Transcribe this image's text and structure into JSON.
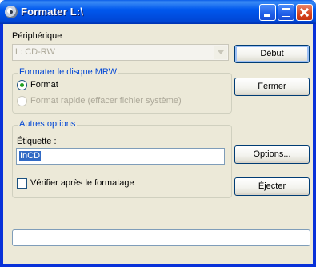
{
  "window": {
    "title": "Formater L:\\"
  },
  "device": {
    "label": "Périphérique",
    "selected": "L: CD-RW"
  },
  "format_group": {
    "title": "Formater le disque MRW",
    "option_format": "Format",
    "option_quick": "Format rapide (effacer fichier système)"
  },
  "other_group": {
    "title": "Autres options",
    "label_label": "Étiquette :",
    "label_value": "InCD",
    "verify_label": "Vérifier après le formatage"
  },
  "buttons": {
    "start": "Début",
    "close": "Fermer",
    "options": "Options...",
    "eject": "Éjecter"
  },
  "status": {
    "text": ""
  }
}
